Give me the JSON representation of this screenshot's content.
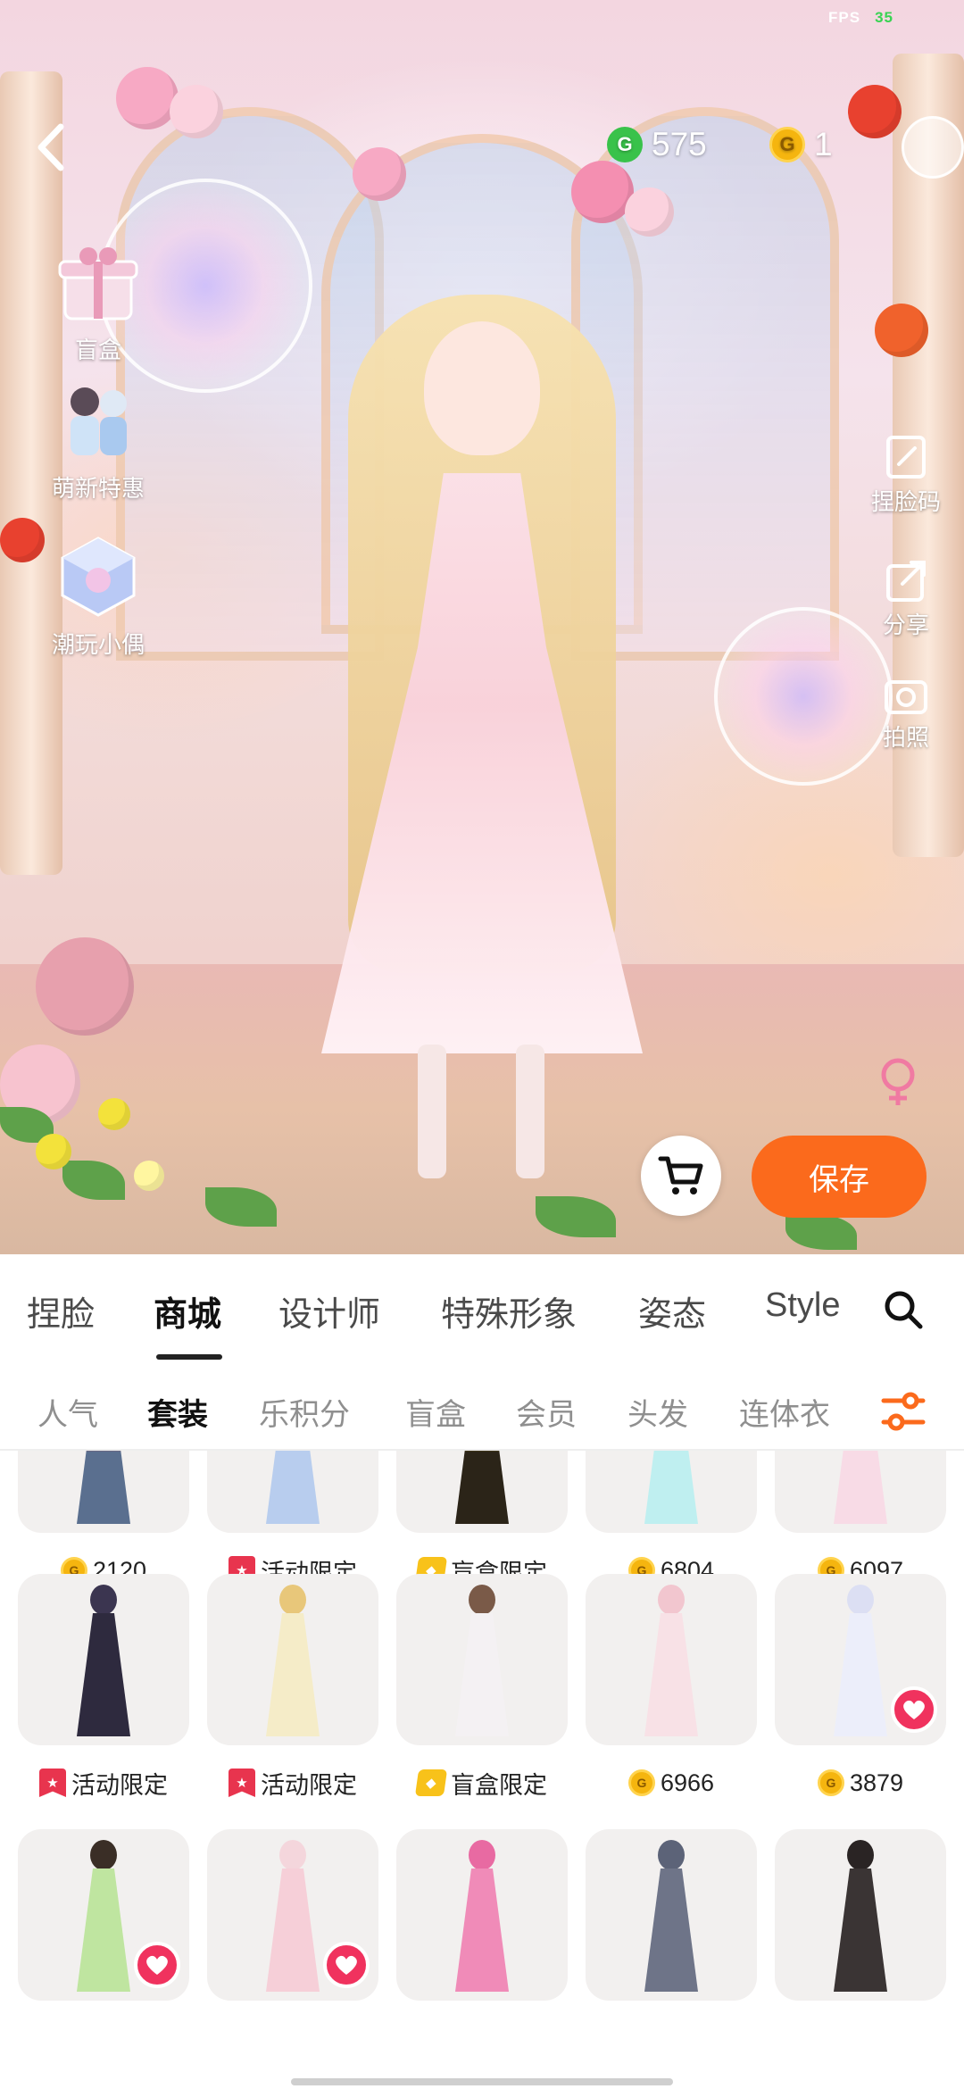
{
  "status": {
    "fps_label": "FPS",
    "fps_value": "35"
  },
  "header": {
    "back_icon": "chevron-left-icon",
    "green_currency": {
      "icon": "g-coin-icon",
      "value": "575",
      "color": "#39c24a"
    },
    "gold_currency": {
      "icon": "gold-coin-icon",
      "value": "1",
      "color": "#f5b50f"
    }
  },
  "left_menu": [
    {
      "label": "盲盒",
      "icon": "gift-box-icon"
    },
    {
      "label": "萌新特惠",
      "icon": "couple-avatar-icon"
    },
    {
      "label": "潮玩小偶",
      "icon": "crystal-cube-icon"
    }
  ],
  "right_tools": [
    {
      "label": "捏脸码",
      "icon": "edit-code-icon"
    },
    {
      "label": "分享",
      "icon": "share-icon"
    },
    {
      "label": "拍照",
      "icon": "camera-icon"
    }
  ],
  "actions": {
    "save_label": "保存",
    "cart_icon": "cart-icon",
    "gender_icon": "gender-icon",
    "accent": "#fb6a1c"
  },
  "tabs": [
    {
      "label": "捏脸",
      "active": false
    },
    {
      "label": "商城",
      "active": true
    },
    {
      "label": "设计师",
      "active": false
    },
    {
      "label": "特殊形象",
      "active": false
    },
    {
      "label": "姿态",
      "active": false
    },
    {
      "label": "Style",
      "active": false
    }
  ],
  "subtabs": [
    {
      "label": "人气",
      "active": false
    },
    {
      "label": "套装",
      "active": true
    },
    {
      "label": "乐积分",
      "active": false
    },
    {
      "label": "盲盒",
      "active": false
    },
    {
      "label": "会员",
      "active": false
    },
    {
      "label": "头发",
      "active": false
    },
    {
      "label": "连体衣",
      "active": false
    }
  ],
  "items_row1": [
    {
      "price_type": "coin",
      "price": "2120"
    },
    {
      "price_type": "event",
      "price": "活动限定"
    },
    {
      "price_type": "blindbox",
      "price": "盲盒限定"
    },
    {
      "price_type": "coin",
      "price": "6804"
    },
    {
      "price_type": "coin",
      "price": "6097"
    }
  ],
  "items_row2": [
    {
      "price_type": "event",
      "price": "活动限定",
      "liked": false
    },
    {
      "price_type": "event",
      "price": "活动限定",
      "liked": false
    },
    {
      "price_type": "blindbox",
      "price": "盲盒限定",
      "liked": false
    },
    {
      "price_type": "coin",
      "price": "6966",
      "liked": false
    },
    {
      "price_type": "coin",
      "price": "3879",
      "liked": true
    }
  ],
  "items_row3": [
    {
      "liked": true
    },
    {
      "liked": true
    },
    {
      "liked": false
    },
    {
      "liked": false
    },
    {
      "liked": false
    }
  ]
}
